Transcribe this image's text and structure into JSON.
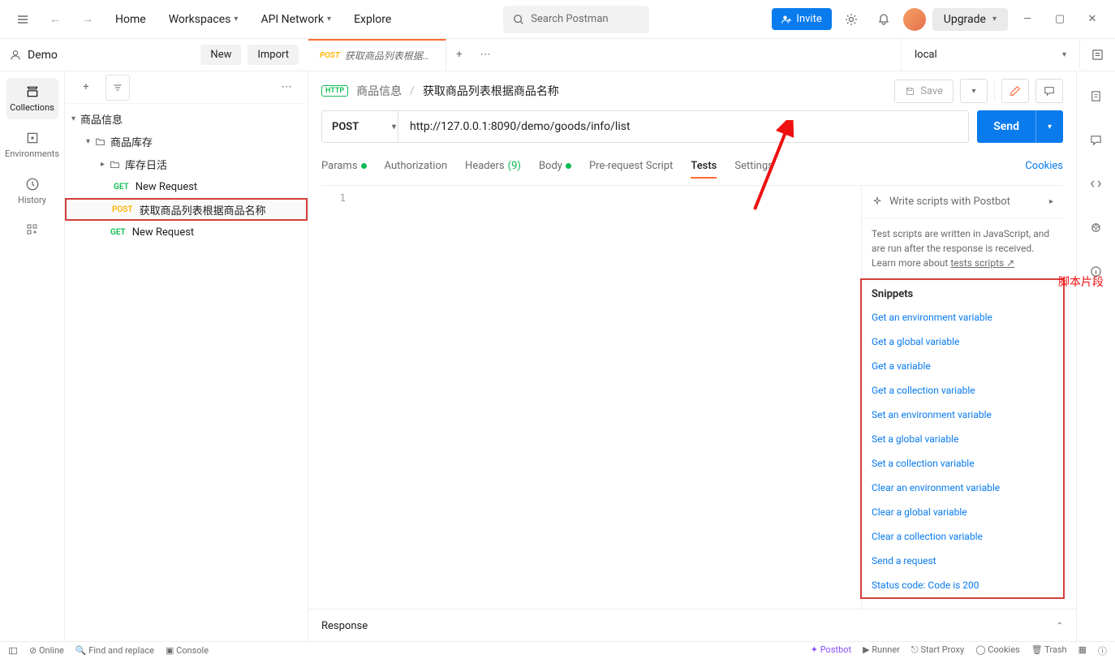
{
  "topbar": {
    "home": "Home",
    "workspaces": "Workspaces",
    "api_network": "API Network",
    "explore": "Explore",
    "search_placeholder": "Search Postman",
    "invite": "Invite",
    "upgrade": "Upgrade"
  },
  "workspace": {
    "name": "Demo",
    "new": "New",
    "import": "Import",
    "env": "local"
  },
  "leftrail": {
    "collections": "Collections",
    "environments": "Environments",
    "history": "History"
  },
  "tree": {
    "root": "商品信息",
    "folder": "商品库存",
    "sub": "库存日活",
    "req1": {
      "method": "GET",
      "name": "New Request"
    },
    "req2": {
      "method": "POST",
      "name": "获取商品列表根据商品名称"
    },
    "req3": {
      "method": "GET",
      "name": "New Request"
    }
  },
  "tab": {
    "method": "POST",
    "title": "获取商品列表根据商品名"
  },
  "breadcrumb": {
    "badge": "HTTP",
    "parent": "商品信息",
    "current": "获取商品列表根据商品名称"
  },
  "save": "Save",
  "request": {
    "method": "POST",
    "url": "http://127.0.0.1:8090/demo/goods/info/list",
    "send": "Send"
  },
  "reqtabs": {
    "params": "Params",
    "auth": "Authorization",
    "headers": "Headers",
    "headers_count": "(9)",
    "body": "Body",
    "prereq": "Pre-request Script",
    "tests": "Tests",
    "settings": "Settings",
    "cookies": "Cookies"
  },
  "editor": {
    "line1": "1"
  },
  "postbot": "Write scripts with Postbot",
  "snip_desc": "Test scripts are written in JavaScript, and are run after the response is received. Learn more about ",
  "snip_link": "tests scripts ↗",
  "snip_head": "Snippets",
  "annotation": "脚本片段",
  "snippets": [
    "Get an environment variable",
    "Get a global variable",
    "Get a variable",
    "Get a collection variable",
    "Set an environment variable",
    "Set a global variable",
    "Set a collection variable",
    "Clear an environment variable",
    "Clear a global variable",
    "Clear a collection variable",
    "Send a request",
    "Status code: Code is 200"
  ],
  "response": "Response",
  "footer": {
    "online": "Online",
    "find": "Find and replace",
    "console": "Console",
    "postbot": "Postbot",
    "runner": "Runner",
    "proxy": "Start Proxy",
    "cookies": "Cookies",
    "trash": "Trash"
  }
}
